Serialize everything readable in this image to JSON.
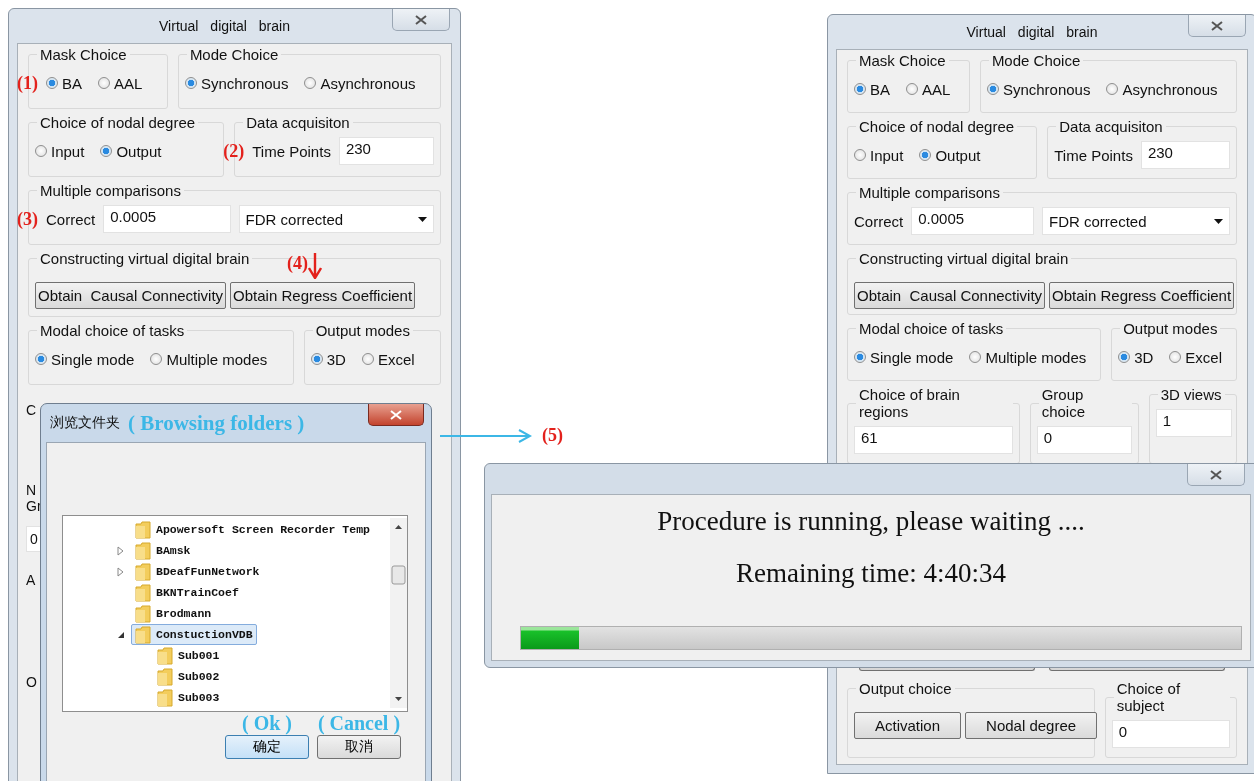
{
  "left_window": {
    "title": "Virtual digital brain",
    "rows": [
      {
        "groups": [
          {
            "title": "Mask Choice",
            "kind": "radio",
            "annotation": "(1)",
            "options": [
              {
                "label": "BA",
                "selected": true
              },
              {
                "label": "AAL",
                "selected": false
              }
            ]
          },
          {
            "title": "Mode Choice",
            "kind": "radio",
            "options": [
              {
                "label": "Synchronous",
                "selected": true
              },
              {
                "label": "Asynchronous",
                "selected": false
              }
            ]
          }
        ]
      },
      {
        "groups": [
          {
            "title": "Choice of nodal degree",
            "kind": "radio",
            "options": [
              {
                "label": "Input",
                "selected": false
              },
              {
                "label": "Output",
                "selected": true
              }
            ]
          },
          {
            "title": "Data acquisiton",
            "kind": "field",
            "annotation": "(2)",
            "fields": [
              {
                "label": "Time Points",
                "value": "230"
              }
            ]
          }
        ]
      },
      {
        "groups": [
          {
            "title": "Multiple comparisons",
            "kind": "field",
            "annotation": "(3)",
            "fields": [
              {
                "label": "Correct",
                "value": "0.0005"
              }
            ],
            "dropdown": "FDR corrected"
          }
        ]
      },
      {
        "groups": [
          {
            "title": "Constructing virtual digital brain",
            "kind": "buttons",
            "annotation": "(4)",
            "buttons": [
              "Obtain  Causal Connectivity",
              "Obtain Regress Coefficient"
            ]
          }
        ]
      },
      {
        "groups": [
          {
            "title": "Modal choice of tasks",
            "kind": "radio",
            "options": [
              {
                "label": "Single mode",
                "selected": true
              },
              {
                "label": "Multiple modes",
                "selected": false
              }
            ]
          },
          {
            "title": "Output modes",
            "kind": "radio",
            "options": [
              {
                "label": "3D",
                "selected": true
              },
              {
                "label": "Excel",
                "selected": false
              }
            ]
          }
        ]
      }
    ],
    "covered_labels": [
      {
        "kind": "label",
        "text": "C"
      },
      {
        "kind": "label",
        "text": "N"
      },
      {
        "kind": "label",
        "text": "Gr"
      },
      {
        "kind": "field",
        "text": "0"
      },
      {
        "kind": "label",
        "text": "A"
      },
      {
        "kind": "label",
        "text": "O"
      }
    ]
  },
  "right_window": {
    "title": "Virtual digital brain",
    "rows": [
      {
        "groups": [
          {
            "title": "Mask Choice",
            "kind": "radio",
            "options": [
              {
                "label": "BA",
                "selected": true
              },
              {
                "label": "AAL",
                "selected": false
              }
            ]
          },
          {
            "title": "Mode Choice",
            "kind": "radio",
            "options": [
              {
                "label": "Synchronous",
                "selected": true
              },
              {
                "label": "Asynchronous",
                "selected": false
              }
            ]
          }
        ]
      },
      {
        "groups": [
          {
            "title": "Choice of nodal degree",
            "kind": "radio",
            "options": [
              {
                "label": "Input",
                "selected": false
              },
              {
                "label": "Output",
                "selected": true
              }
            ]
          },
          {
            "title": "Data acquisiton",
            "kind": "field",
            "fields": [
              {
                "label": "Time Points",
                "value": "230"
              }
            ]
          }
        ]
      },
      {
        "groups": [
          {
            "title": "Multiple comparisons",
            "kind": "field",
            "fields": [
              {
                "label": "Correct",
                "value": "0.0005"
              }
            ],
            "dropdown": "FDR corrected"
          }
        ]
      },
      {
        "groups": [
          {
            "title": "Constructing virtual digital brain",
            "kind": "buttons",
            "buttons": [
              "Obtain  Causal Connectivity",
              "Obtain Regress Coefficient"
            ]
          }
        ]
      },
      {
        "groups": [
          {
            "title": "Modal choice of tasks",
            "kind": "radio",
            "options": [
              {
                "label": "Single mode",
                "selected": true
              },
              {
                "label": "Multiple modes",
                "selected": false
              }
            ]
          },
          {
            "title": "Output modes",
            "kind": "radio",
            "options": [
              {
                "label": "3D",
                "selected": true
              },
              {
                "label": "Excel",
                "selected": false
              }
            ]
          }
        ]
      },
      {
        "groups": [
          {
            "title": "Choice of brain regions",
            "kind": "field",
            "fields": [
              {
                "value": "61"
              }
            ]
          },
          {
            "title": "Group choice",
            "kind": "field",
            "fields": [
              {
                "value": "0"
              }
            ]
          },
          {
            "title": "3D views",
            "kind": "field",
            "fields": [
              {
                "value": "1"
              }
            ]
          }
        ]
      }
    ],
    "bottom_rows": [
      {
        "groups": [
          {
            "title": "Output choice",
            "kind": "buttons",
            "buttons": [
              "Activation",
              "Nodal degree"
            ]
          },
          {
            "title": "Choice of subject",
            "kind": "field",
            "fields": [
              {
                "value": "0"
              }
            ]
          }
        ]
      }
    ]
  },
  "browse_dialog": {
    "title": "浏览文件夹",
    "title_annotation": "( Browsing folders )",
    "folders": [
      {
        "name": "Apowersoft Screen Recorder Temp",
        "selected": false
      },
      {
        "name": "BAmsk",
        "selected": false,
        "expanded": false
      },
      {
        "name": "BDeafFunNetwork",
        "selected": false,
        "expanded": false
      },
      {
        "name": "BKNTrainCoef",
        "selected": false
      },
      {
        "name": "Brodmann",
        "selected": false
      },
      {
        "name": "ConstuctionVDB",
        "selected": true,
        "expanded": true,
        "children": [
          {
            "name": "Sub001",
            "selected": false
          },
          {
            "name": "Sub002",
            "selected": false
          },
          {
            "name": "Sub003",
            "selected": false
          }
        ]
      }
    ],
    "buttons": [
      {
        "label": "确定",
        "annotation": "( Ok )",
        "selected": true
      },
      {
        "label": "取消",
        "annotation": "( Cancel )",
        "selected": false
      }
    ]
  },
  "step_annotation": "(5)",
  "progress_dialog": {
    "message": "Procedure is running, please waiting ....",
    "remaining": "Remaining time: 4:40:34",
    "level": 0.08
  }
}
